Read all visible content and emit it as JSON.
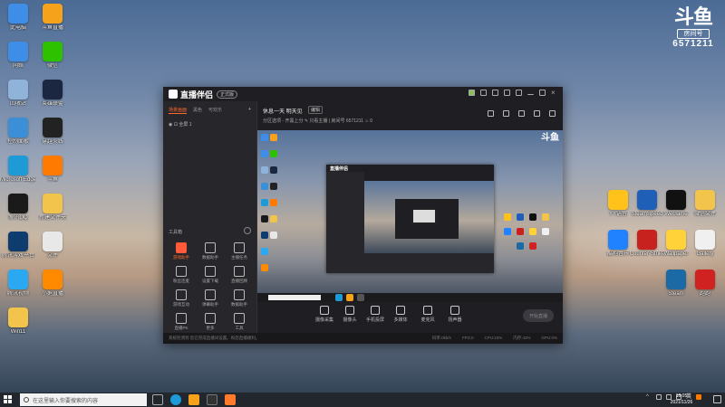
{
  "desktop": {
    "left_icons": [
      {
        "label": "此电脑",
        "icon": "computer-icon",
        "color": "#3e8ee8"
      },
      {
        "label": "斗鱼直播",
        "icon": "douyu-app-icon",
        "color": "#f7a21b"
      },
      {
        "label": "网络",
        "icon": "network-icon",
        "color": "#3e8ee8"
      },
      {
        "label": "微信",
        "icon": "wechat-icon",
        "color": "#2dc100"
      },
      {
        "label": "回收站",
        "icon": "recycle-bin-icon",
        "color": "#8fb3d9"
      },
      {
        "label": "英雄联盟",
        "icon": "lol-icon",
        "color": "#1b2740"
      },
      {
        "label": "控制面板",
        "icon": "control-panel-icon",
        "color": "#3b8fd6"
      },
      {
        "label": "穿越火线",
        "icon": "crossfire-icon",
        "color": "#222"
      },
      {
        "label": "Microsoft Edge",
        "icon": "edge-icon",
        "color": "#1e9ad6"
      },
      {
        "label": "斗鱼",
        "icon": "douyu-icon",
        "color": "#ff7a00"
      },
      {
        "label": "腾讯QQ",
        "icon": "qq-icon",
        "color": "#1a1a1a"
      },
      {
        "label": "新建文件夹",
        "icon": "folder-icon",
        "color": "#f3c44b"
      },
      {
        "label": "腾讯游戏平台",
        "icon": "tgp-icon",
        "color": "#0e3c6e"
      },
      {
        "label": "文件",
        "icon": "file-icon",
        "color": "#e8e8e8"
      },
      {
        "label": "腾讯视频",
        "icon": "video-icon",
        "color": "#2aa8f2"
      },
      {
        "label": "小鹅直播",
        "icon": "live-icon",
        "color": "#ff8a00"
      },
      {
        "label": "Win11",
        "icon": "file-icon",
        "color": "#f3c44b"
      }
    ],
    "right_icons": [
      {
        "label": "YY语音",
        "icon": "yy-icon",
        "color": "#ffc21a"
      },
      {
        "label": "SteamSpeed",
        "icon": "speed-icon",
        "color": "#1f5fb8"
      },
      {
        "label": "WeGame",
        "icon": "wegame-icon",
        "color": "#111"
      },
      {
        "label": "微信文件",
        "icon": "folder-icon",
        "color": "#f3c44b"
      },
      {
        "label": "酷狗音乐",
        "icon": "kugou-icon",
        "color": "#2182ff"
      },
      {
        "label": "Counter-Strike",
        "icon": "cs-icon",
        "color": "#c8221f"
      },
      {
        "label": "Wallpaper",
        "icon": "wallpaper-icon",
        "color": "#ffd23a"
      },
      {
        "label": "Gallery",
        "icon": "gallery-icon",
        "color": "#f0f0f0"
      },
      {
        "label": "Steam",
        "icon": "steam-icon",
        "color": "#1b6aa5"
      },
      {
        "label": "跑跑",
        "icon": "runner-icon",
        "color": "#d12222"
      }
    ],
    "douyu_badge": {
      "logo": "斗鱼",
      "room_label": "房间号",
      "room_number": "6571211"
    }
  },
  "app": {
    "name": "直播伴侣",
    "version": "正式版",
    "left_tabs": [
      "场景画面",
      "黑色",
      "可欢乐"
    ],
    "scene_item": "全屏 1",
    "tools_title": "工具箱",
    "tools": [
      {
        "label": "游戏助手",
        "icon": "game-helper-icon"
      },
      {
        "label": "数据助手",
        "icon": "data-helper-icon"
      },
      {
        "label": "主播任务",
        "icon": "task-icon"
      },
      {
        "label": "粉丝连麦",
        "icon": "fans-mic-icon"
      },
      {
        "label": "设置下载",
        "icon": "download-icon"
      },
      {
        "label": "直播回顾",
        "icon": "review-icon"
      },
      {
        "label": "游戏互动",
        "icon": "game-interact-icon"
      },
      {
        "label": "弹幕助手",
        "icon": "danmaku-icon"
      },
      {
        "label": "数据助手",
        "icon": "data-icon"
      },
      {
        "label": "直播PK",
        "icon": "pk-icon"
      },
      {
        "label": "更多",
        "icon": "more-icon"
      },
      {
        "label": "工具",
        "icon": "tool-icon"
      }
    ],
    "room_title": "休息一天 明天见",
    "room_edit": "编辑",
    "room_sub": "分区选项 - 开黑上分 ✎    只看主播 | 房间号 6571211    ♨ 0",
    "controls": [
      {
        "label": "摄像采集",
        "icon": "capture-icon"
      },
      {
        "label": "摄像头",
        "icon": "camera-icon"
      },
      {
        "label": "手机投屏",
        "icon": "phone-cast-icon"
      },
      {
        "label": "多媒体",
        "icon": "media-icon"
      },
      {
        "label": "麦克风",
        "icon": "mic-icon"
      },
      {
        "label": "扬声器",
        "icon": "speaker-icon"
      }
    ],
    "go_live": "开始直播",
    "status_tip": "系统检测到 您已完成直播间设置。祝您直播顺利。",
    "status_stats": [
      "码率:0kb/s",
      "FPS:0",
      "CPU:23%",
      "内存:43%",
      "GPU:0%"
    ],
    "nested_logo": "直播伴侣"
  },
  "taskbar": {
    "search_placeholder": "在这里输入你要搜索的内容",
    "time": "18:05",
    "date": "2021/11/26",
    "ime": "英"
  }
}
